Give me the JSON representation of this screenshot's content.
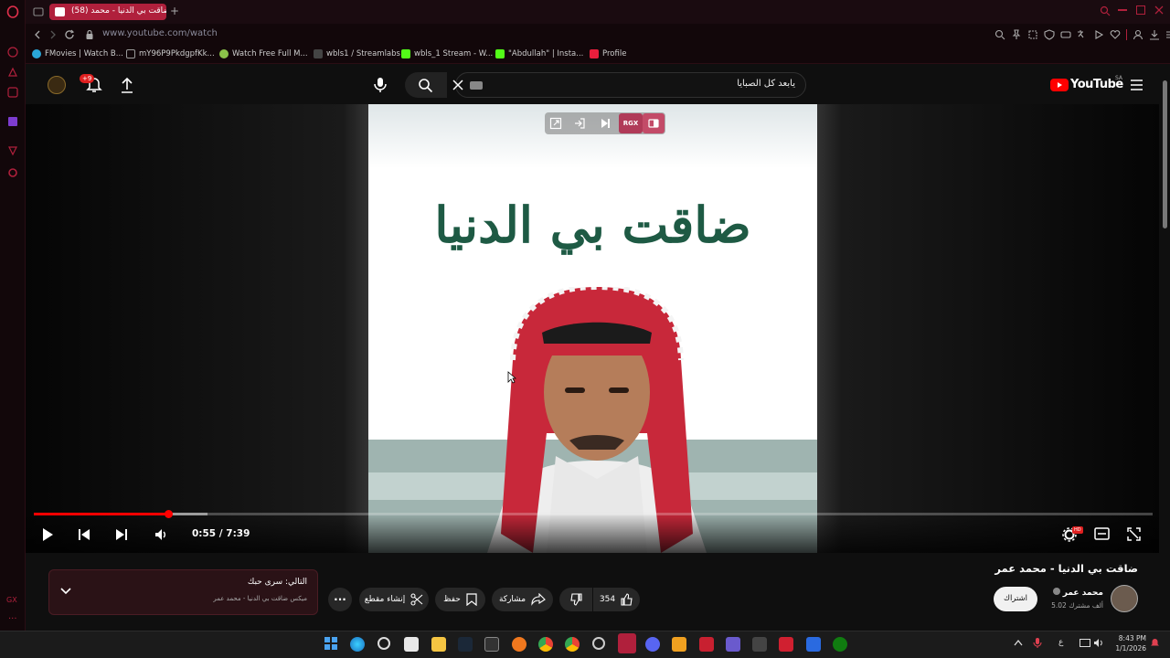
{
  "browser": {
    "tab_badge": "(58)",
    "tab_title": "ضاقت بي الدنيا - محمد",
    "url": "www.youtube.com/watch",
    "bookmarks": [
      {
        "label": "FMovies | Watch B...",
        "color": "#2aa7d8"
      },
      {
        "label": "mY96P9PkdgpfKk...",
        "color": "#999"
      },
      {
        "label": "Watch Free Full M...",
        "color": "#8bc34a"
      },
      {
        "label": "wbls1 / Streamlabs",
        "color": "#555"
      },
      {
        "label": "wbls_1 Stream - W...",
        "color": "#53fc18"
      },
      {
        "label": "\"Abdullah\" | Insta...",
        "color": "#53fc18"
      },
      {
        "label": "Profile",
        "color": "#e91e3c"
      }
    ],
    "sidebar_label": "GX"
  },
  "youtube": {
    "search_query": "يابعد كل الصبايا",
    "logo_text": "YouTube",
    "region": "SA",
    "notif_count": "+9",
    "video_title": "ضاقت بي الدنيا - محمد عمر",
    "thumbnail_title": "ضاقت بي الدنيا",
    "time_text": "0:55 / 7:39",
    "progress_fraction": 0.12,
    "buffer_fraction": 0.155,
    "rgx_label": "RGX",
    "settings_badge": "HD",
    "channel_name": "محمد عمر",
    "subscribers": "5.02 ألف مشترك",
    "subscribe_label": "اشتراك",
    "likes": "354",
    "share_label": "مشاركة",
    "save_label": "حفظ",
    "clip_label": "إنشاء مقطع",
    "next_label": "التالي: سرى حبك",
    "next_sub": "ميكس ضاقت بي الدنيا - محمد عمر"
  },
  "taskbar": {
    "time": "8:43 PM",
    "date": "1/1/2026",
    "lang": "ع"
  },
  "colors": {
    "accent": "#ff0000",
    "gx_red": "#b0203c",
    "thumb_green": "#1e5a44"
  }
}
